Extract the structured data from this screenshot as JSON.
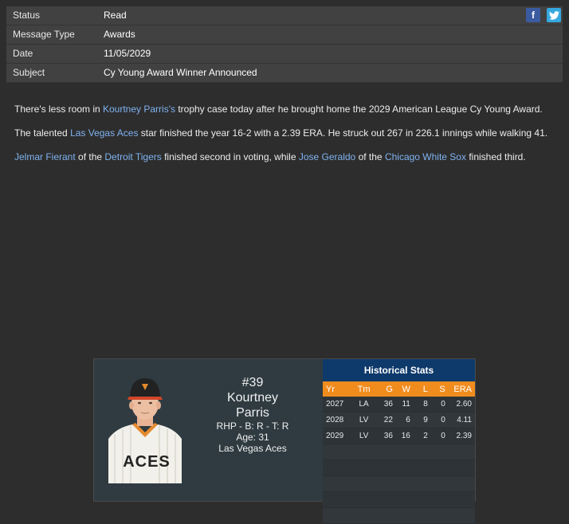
{
  "header": {
    "rows": [
      {
        "label": "Status",
        "value": "Read"
      },
      {
        "label": "Message Type",
        "value": "Awards"
      },
      {
        "label": "Date",
        "value": "11/05/2029"
      },
      {
        "label": "Subject",
        "value": "Cy Young Award Winner Announced"
      }
    ],
    "facebook_glyph": "f",
    "twitter_glyph": "t"
  },
  "article": {
    "p1": {
      "t1": "There's less room in ",
      "l1": "Kourtney Parris's",
      "t2": " trophy case today after he brought home the 2029 American League Cy Young Award."
    },
    "p2": {
      "t1": "The talented ",
      "l1": "Las Vegas Aces",
      "t2": " star finished the year 16-2 with a 2.39 ERA. He struck out 267 in 226.1 innings while walking 41."
    },
    "p3": {
      "l1": "Jelmar Fierant",
      "t1": " of the ",
      "l2": "Detroit Tigers",
      "t2": " finished second in voting, while ",
      "l3": "Jose Geraldo",
      "t3": " of the ",
      "l4": "Chicago White Sox",
      "t4": " finished third."
    }
  },
  "player": {
    "number": "#39",
    "first_name": "Kourtney",
    "last_name": "Parris",
    "position_line": "RHP - B: R - T: R",
    "age_line": "Age: 31",
    "team": "Las Vegas Aces",
    "jersey_text": "ACES"
  },
  "historical": {
    "title": "Historical Stats",
    "columns": [
      "Yr",
      "Tm",
      "G",
      "W",
      "L",
      "S",
      "ERA"
    ],
    "rows": [
      [
        "2027",
        "LA",
        "36",
        "11",
        "8",
        "0",
        "2.60"
      ],
      [
        "2028",
        "LV",
        "22",
        "6",
        "9",
        "0",
        "4.11"
      ],
      [
        "2029",
        "LV",
        "36",
        "16",
        "2",
        "0",
        "2.39"
      ]
    ]
  },
  "colors": {
    "link": "#7fb2f0",
    "stats_header": "#f08c1e",
    "stats_title_bg": "#0e3a6b"
  }
}
